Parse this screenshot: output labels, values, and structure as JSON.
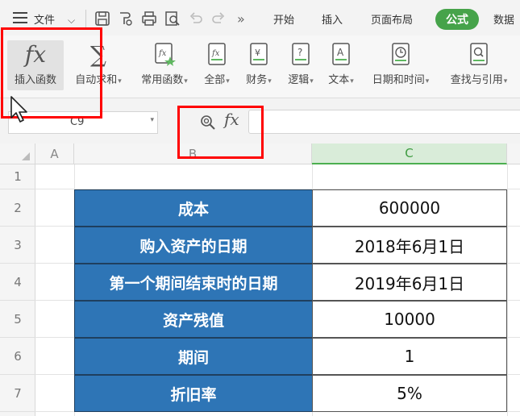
{
  "menubar": {
    "file_label": "文件",
    "tabs": [
      {
        "label": "开始"
      },
      {
        "label": "插入"
      },
      {
        "label": "页面布局"
      },
      {
        "label": "公式",
        "active": true
      },
      {
        "label": "数据"
      }
    ],
    "more_label": "»"
  },
  "ribbon": {
    "insert_function": {
      "icon": "fx",
      "label": "插入函数"
    },
    "auto_sum": {
      "label": "自动求和"
    },
    "common_functions": {
      "label": "常用函数"
    },
    "all": {
      "label": "全部"
    },
    "finance": {
      "label": "财务"
    },
    "logic": {
      "label": "逻辑"
    },
    "text": {
      "label": "文本"
    },
    "date_time": {
      "label": "日期和时间"
    },
    "lookup": {
      "label": "查找与引用"
    }
  },
  "formula_bar": {
    "name_box": "C9",
    "fx_label": "fx",
    "formula": ""
  },
  "columns": [
    "A",
    "B",
    "C"
  ],
  "rows": [
    "1",
    "2",
    "3",
    "4",
    "5",
    "6",
    "7"
  ],
  "table": [
    {
      "label": "成本",
      "value": "600000"
    },
    {
      "label": "购入资产的日期",
      "value": "2018年6月1日"
    },
    {
      "label": "第一个期间结束时的日期",
      "value": "2019年6月1日"
    },
    {
      "label": "资产残值",
      "value": "10000"
    },
    {
      "label": "期间",
      "value": "1"
    },
    {
      "label": "折旧率",
      "value": "5%"
    }
  ],
  "colors": {
    "accent_green": "#46a34a",
    "table_header_blue": "#2e75b6",
    "highlight_red": "#ff0000"
  }
}
